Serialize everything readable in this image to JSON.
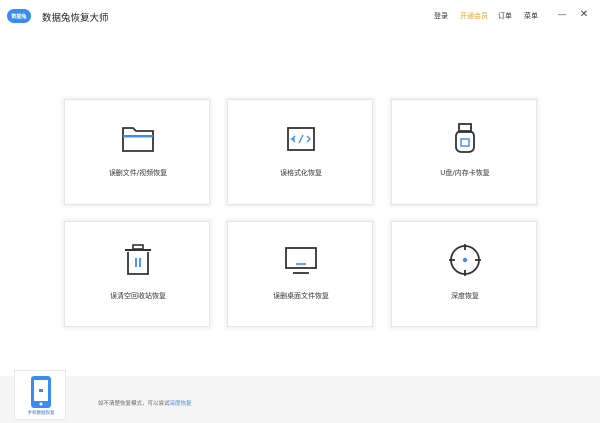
{
  "app": {
    "logo_text": "数据兔",
    "title": "数据兔恢复大师"
  },
  "topnav": {
    "login": "登录",
    "vip": "开通会员",
    "orders": "订单",
    "menu": "菜单"
  },
  "window": {
    "minimize": "—",
    "close": "✕"
  },
  "cards": [
    {
      "label": "误删文件/视频恢复",
      "icon": "folder-icon"
    },
    {
      "label": "误格式化恢复",
      "icon": "code-window-icon"
    },
    {
      "label": "U盘/内存卡恢复",
      "icon": "usb-drive-icon"
    },
    {
      "label": "误清空回收站恢复",
      "icon": "trash-icon"
    },
    {
      "label": "误删桌面文件恢复",
      "icon": "monitor-icon"
    },
    {
      "label": "深度恢复",
      "icon": "crosshair-icon"
    }
  ],
  "footer": {
    "phone_label": "手机数据恢复",
    "hint_text": "如不清楚恢复模式，可以尝试",
    "hint_link": "深度恢复"
  },
  "colors": {
    "accent": "#3b8cf0",
    "vip": "#f0a020",
    "icon": "#333333"
  }
}
